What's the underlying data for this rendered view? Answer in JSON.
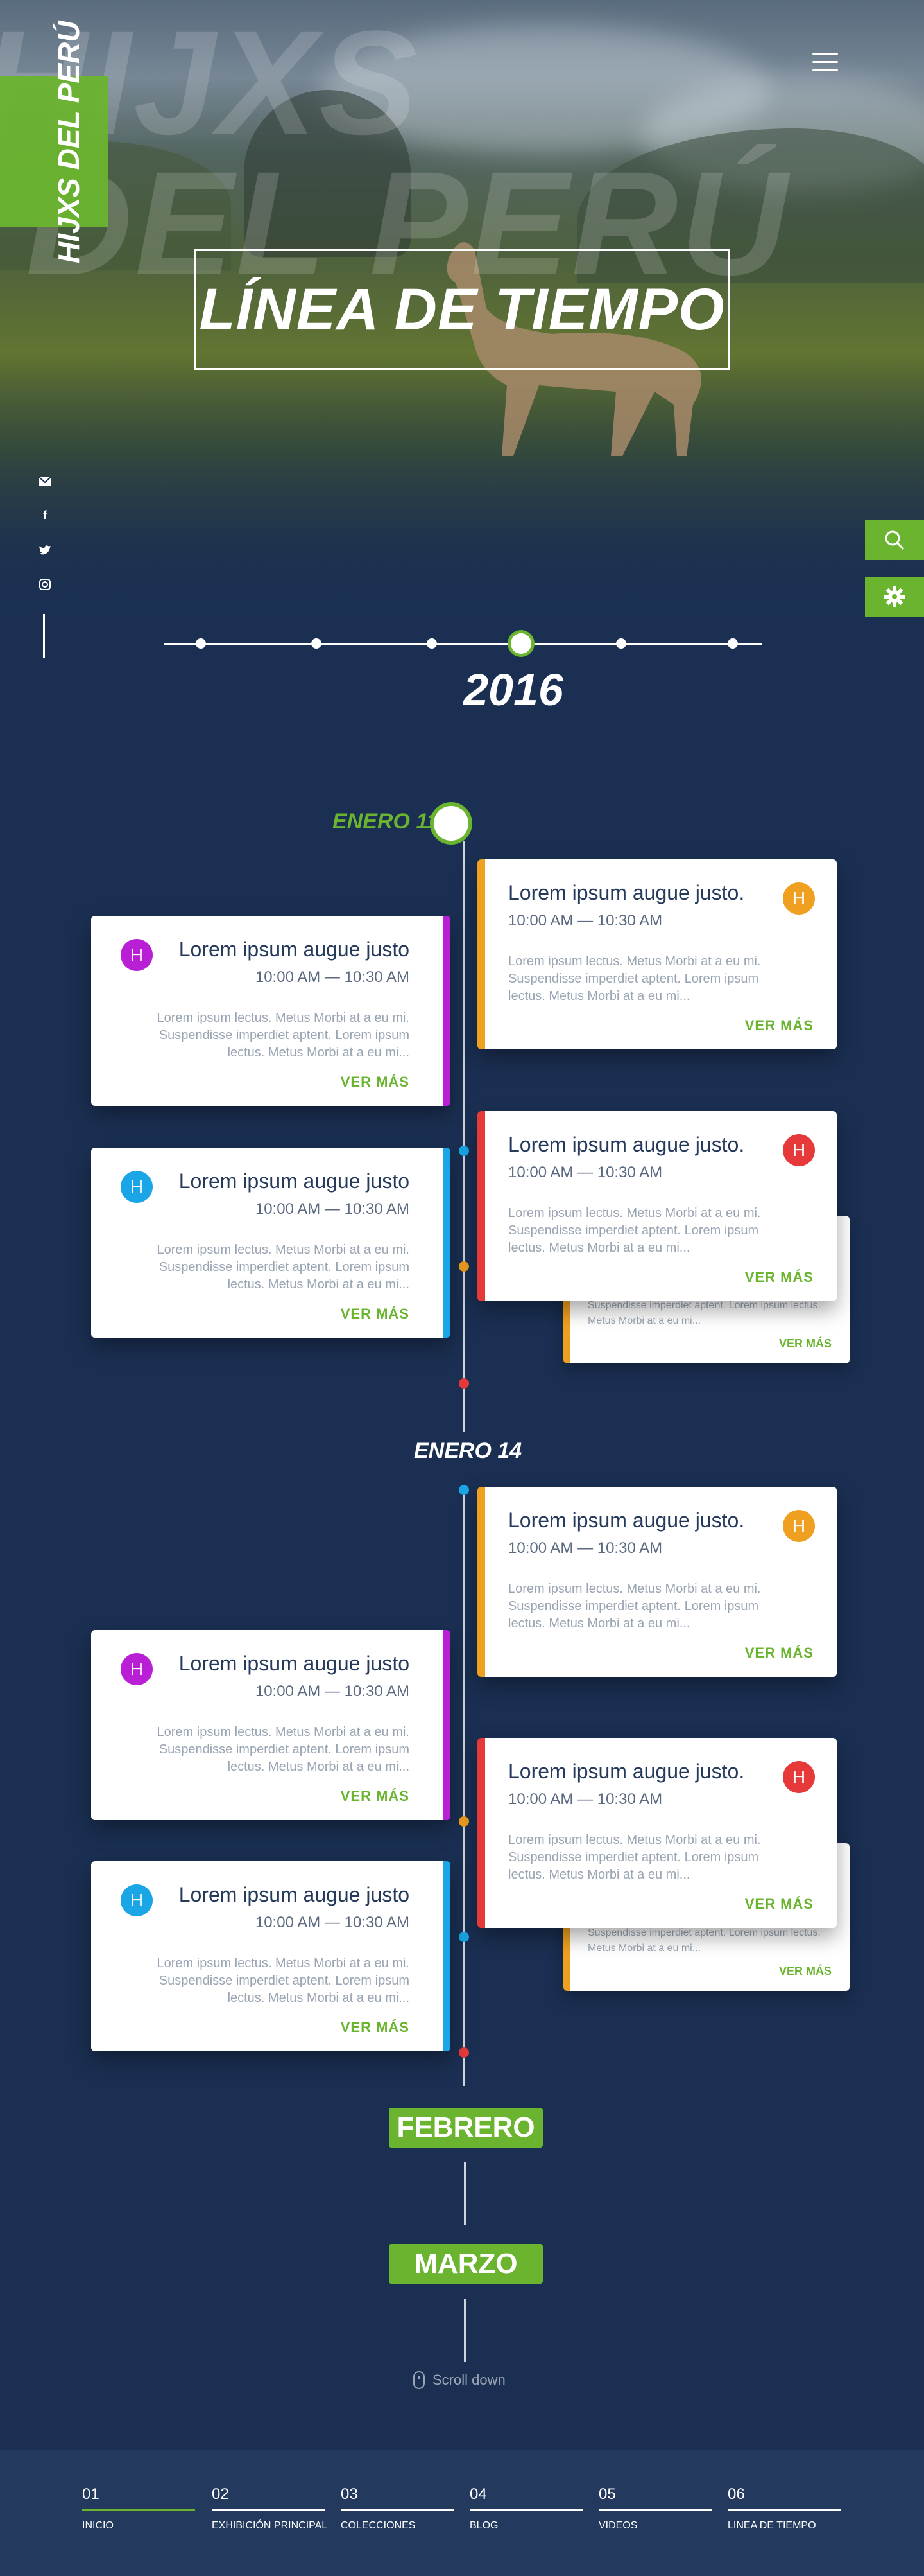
{
  "brand": {
    "name": "HIJXS DEL PERÚ",
    "watermark_line1": "HIJXS",
    "watermark_line2": "DEL PERÚ"
  },
  "hero": {
    "title": "LÍNEA DE TIEMPO"
  },
  "social": [
    "email-icon",
    "facebook-icon",
    "twitter-icon",
    "instagram-icon"
  ],
  "tools": {
    "search": "search-icon",
    "settings": "gear-icon"
  },
  "year_slider": {
    "active_year": "2016",
    "dots": 6,
    "active_index": 3
  },
  "groups": [
    {
      "date": "ENERO 11"
    },
    {
      "date": "ENERO 14"
    }
  ],
  "card": {
    "title_left": "Lorem ipsum augue justo",
    "title_right": "Lorem ipsum augue justo.",
    "time": "10:00 AM — 10:30 AM",
    "text": "Lorem ipsum lectus. Metus Morbi at a eu mi. Suspendisse imperdiet aptent. Lorem ipsum lectus. Metus Morbi at a eu mi...",
    "ghost_text": "Suspendisse imperdiet aptent. Lorem ipsum lectus. Metus Morbi at a eu mi...",
    "more": "VER MÁS",
    "avatar": "H"
  },
  "colors": {
    "accent": "#6ab42f",
    "bg": "#1a2f52",
    "orange": "#f0a020",
    "red": "#e63a3a",
    "purple": "#b91fd4",
    "blue": "#1aa6e6"
  },
  "months": [
    "FEBRERO",
    "MARZO"
  ],
  "scroll_label": "Scroll down",
  "footer_nav": [
    {
      "num": "01",
      "label": "INICIO"
    },
    {
      "num": "02",
      "label": "EXHIBICIÓN PRINCIPAL"
    },
    {
      "num": "03",
      "label": "COLECCIONES"
    },
    {
      "num": "04",
      "label": "BLOG"
    },
    {
      "num": "05",
      "label": "VIDEOS"
    },
    {
      "num": "06",
      "label": "LINEA DE TIEMPO"
    }
  ]
}
